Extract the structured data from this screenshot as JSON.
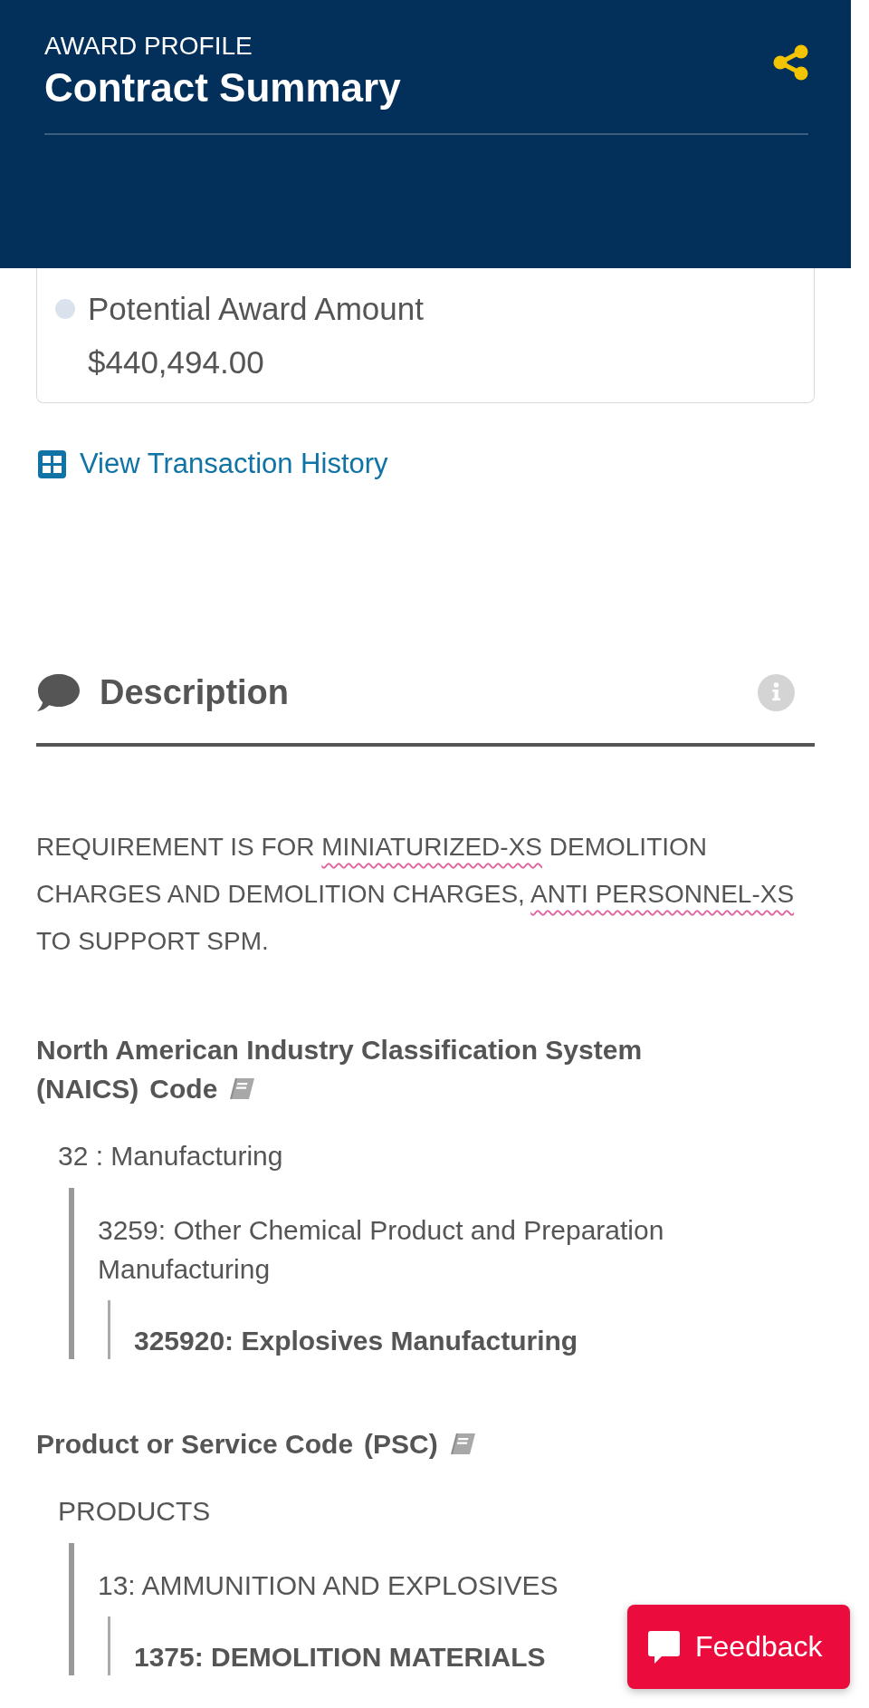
{
  "header": {
    "eyebrow": "AWARD PROFILE",
    "title": "Contract Summary"
  },
  "award_amount": {
    "label": "Potential Award Amount",
    "value": "$440,494.00"
  },
  "transaction_link": {
    "label": "View Transaction History"
  },
  "description": {
    "title": "Description",
    "segments": [
      {
        "text": "REQUIREMENT IS FOR ",
        "pen_underline": false
      },
      {
        "text": "MINIATURIZED-XS",
        "pen_underline": true
      },
      {
        "text": " DEMOLITION CHARGES AND DEMOLITION CHARGES, ",
        "pen_underline": false
      },
      {
        "text": "ANTI PERSONNEL-XS",
        "pen_underline": true
      },
      {
        "text": " TO SUPPORT SPM.",
        "pen_underline": false
      }
    ]
  },
  "code_sections": [
    {
      "title_parts": [
        "North American Industry Classification System",
        "(NAICS)",
        "Code"
      ],
      "tree": [
        {
          "label": "32 : Manufacturing",
          "children": [
            {
              "label": "3259: Other Chemical Product and Preparation Manufacturing",
              "children": [
                {
                  "label": "325920: Explosives Manufacturing"
                }
              ]
            }
          ]
        }
      ]
    },
    {
      "title_parts": [
        "Product or Service Code",
        "(PSC)"
      ],
      "tree": [
        {
          "label": "PRODUCTS",
          "children": [
            {
              "label": "13: AMMUNITION AND EXPLOSIVES",
              "children": [
                {
                  "label": "1375: DEMOLITION MATERIALS"
                }
              ]
            }
          ]
        }
      ]
    }
  ],
  "feedback_button": {
    "label": "Feedback"
  }
}
